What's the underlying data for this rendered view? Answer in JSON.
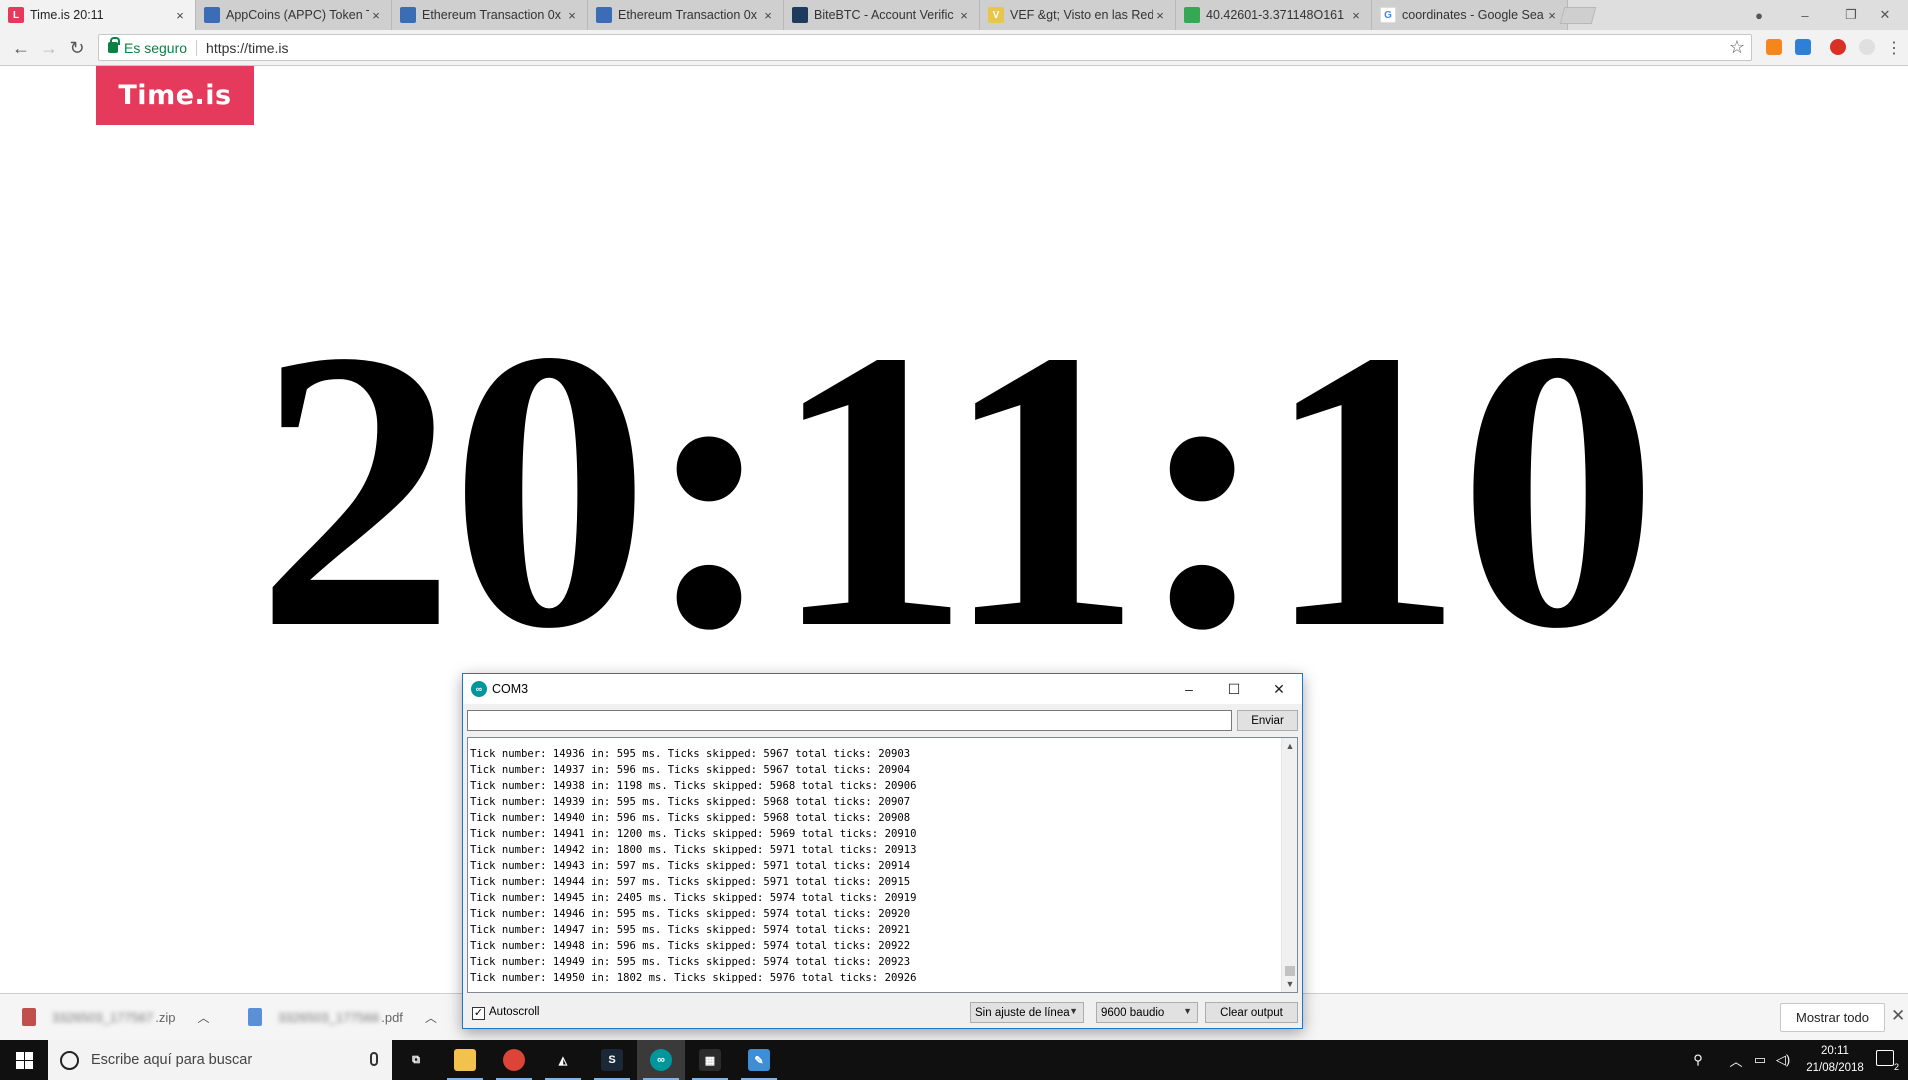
{
  "browser": {
    "tabs": [
      {
        "title": "Time.is 20:11",
        "favicon": "time-is-icon",
        "color": "#e63a5c",
        "glyph": "L",
        "active": true
      },
      {
        "title": "AppCoins (APPC) Token T",
        "favicon": "etherscan-icon",
        "color": "#3a6db5",
        "glyph": "",
        "active": false
      },
      {
        "title": "Ethereum Transaction 0x",
        "favicon": "etherscan-icon",
        "color": "#3a6db5",
        "glyph": "",
        "active": false
      },
      {
        "title": "Ethereum Transaction 0x",
        "favicon": "etherscan-icon",
        "color": "#3a6db5",
        "glyph": "",
        "active": false
      },
      {
        "title": "BiteBTC - Account Verific",
        "favicon": "bitebtc-icon",
        "color": "#1e3a5f",
        "glyph": "",
        "active": false
      },
      {
        "title": "VEF &gt; Visto en las Red",
        "favicon": "vef-icon",
        "color": "#e7c64a",
        "glyph": "V",
        "active": false
      },
      {
        "title": "40.42601-3.371148O161",
        "favicon": "google-maps-icon",
        "color": "#34a853",
        "glyph": "",
        "active": false
      },
      {
        "title": "coordinates - Google Sea",
        "favicon": "google-icon",
        "color": "#ffffff",
        "glyph": "G",
        "active": false
      }
    ],
    "tab_close_glyph": "×",
    "security_label": "Es seguro",
    "url": "https://time.is",
    "star_glyph": "☆"
  },
  "page": {
    "logo": "Time.is",
    "clock": "20:11:10",
    "accent_color": "#e63a5c"
  },
  "downloads": {
    "items": [
      {
        "name": "3326503_177567",
        "ext": ".zip",
        "icon_color": "#c0504d"
      },
      {
        "name": "3326503_177566",
        "ext": ".pdf",
        "icon_color": "#5b8fd6"
      }
    ],
    "show_all_label": "Mostrar todo",
    "close_glyph": "✕"
  },
  "serial_monitor": {
    "title": "COM3",
    "send_label": "Enviar",
    "input_value": "",
    "lines": [
      "Tick number: 14936 in: 595 ms. Ticks skipped: 5967 total ticks: 20903",
      "Tick number: 14937 in: 596 ms. Ticks skipped: 5967 total ticks: 20904",
      "Tick number: 14938 in: 1198 ms. Ticks skipped: 5968 total ticks: 20906",
      "Tick number: 14939 in: 595 ms. Ticks skipped: 5968 total ticks: 20907",
      "Tick number: 14940 in: 596 ms. Ticks skipped: 5968 total ticks: 20908",
      "Tick number: 14941 in: 1200 ms. Ticks skipped: 5969 total ticks: 20910",
      "Tick number: 14942 in: 1800 ms. Ticks skipped: 5971 total ticks: 20913",
      "Tick number: 14943 in: 597 ms. Ticks skipped: 5971 total ticks: 20914",
      "Tick number: 14944 in: 597 ms. Ticks skipped: 5971 total ticks: 20915",
      "Tick number: 14945 in: 2405 ms. Ticks skipped: 5974 total ticks: 20919",
      "Tick number: 14946 in: 595 ms. Ticks skipped: 5974 total ticks: 20920",
      "Tick number: 14947 in: 595 ms. Ticks skipped: 5974 total ticks: 20921",
      "Tick number: 14948 in: 596 ms. Ticks skipped: 5974 total ticks: 20922",
      "Tick number: 14949 in: 595 ms. Ticks skipped: 5974 total ticks: 20923",
      "Tick number: 14950 in: 1802 ms. Ticks skipped: 5976 total ticks: 20926"
    ],
    "autoscroll_label": "Autoscroll",
    "autoscroll_checked": true,
    "line_ending": "Sin ajuste de línea",
    "baud": "9600 baudio",
    "clear_label": "Clear output"
  },
  "taskbar": {
    "search_placeholder": "Escribe aquí para buscar",
    "apps": [
      {
        "name": "task-view-icon",
        "color": "transparent",
        "glyph": "⧉"
      },
      {
        "name": "file-explorer-icon",
        "color": "#f2c14e",
        "glyph": ""
      },
      {
        "name": "chrome-icon",
        "color": "#db4437",
        "glyph": ""
      },
      {
        "name": "unity-icon",
        "color": "transparent",
        "glyph": "◭"
      },
      {
        "name": "steam-icon",
        "color": "#1b2838",
        "glyph": "S"
      },
      {
        "name": "arduino-icon",
        "color": "#00979c",
        "glyph": "∞"
      },
      {
        "name": "calculator-icon",
        "color": "#2b2b2b",
        "glyph": "▦"
      },
      {
        "name": "paint-icon",
        "color": "#3d8ed4",
        "glyph": "✎"
      }
    ],
    "time": "20:11",
    "date": "21/08/2018",
    "notification_count": "2"
  }
}
